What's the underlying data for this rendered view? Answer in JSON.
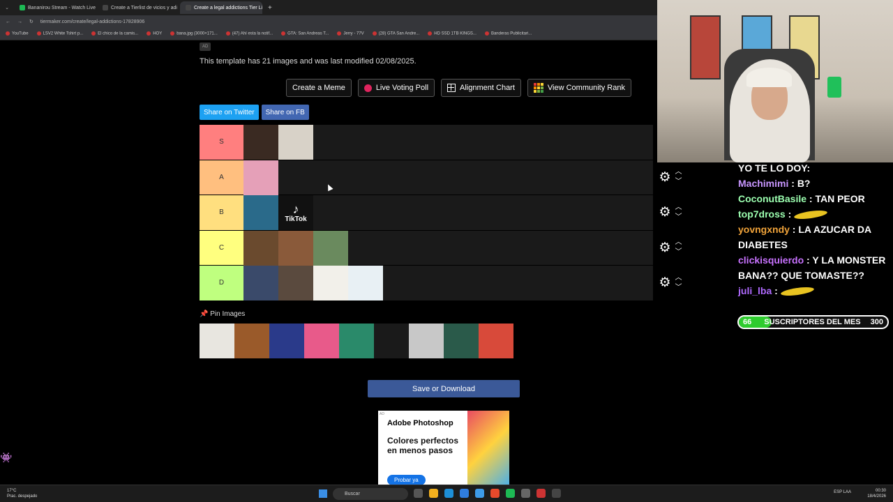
{
  "browser": {
    "tabs": [
      {
        "title": "Bananirou Stream - Watch Live",
        "color": "#1db954",
        "active": false
      },
      {
        "title": "Create a Tierlist de vicios y adi",
        "color": "#444",
        "active": false
      },
      {
        "title": "Create a legal addictions Tier Li",
        "color": "#444",
        "active": true
      }
    ],
    "url": "tiermaker.com/create/legal-addictions-17828906",
    "bookmarks": [
      "YouTube",
      "LSV2 White Tshirt p...",
      "El chico de la camis...",
      "HOY",
      "bana.jpg (3000×171...",
      "(47) Ahí esta la notif...",
      "GTA: San Andreas T...",
      "Jerry - 77V",
      "(28) GTA San Andre...",
      "HD SSD 1TB KINGS...",
      "Banderas Publicitari..."
    ]
  },
  "page": {
    "ad_badge": "AD",
    "template_info": "This template has 21 images and was last modified 02/08/2025.",
    "buttons": {
      "create_meme": "Create a Meme",
      "live_voting": "Live Voting Poll",
      "alignment": "Alignment Chart",
      "community_rank": "View Community Rank"
    },
    "share": {
      "twitter": "Share on Twitter",
      "fb": "Share on FB"
    },
    "tiers": [
      {
        "label": "S",
        "color": "#ff7f7f",
        "tiles": [
          "#3a2a22",
          "#d8d2c8"
        ]
      },
      {
        "label": "A",
        "color": "#ffbf7f",
        "tiles": [
          "#e5a0b8"
        ]
      },
      {
        "label": "B",
        "color": "#ffdf7f",
        "tiles": [
          "#2a6a8a",
          "tiktok"
        ]
      },
      {
        "label": "C",
        "color": "#ffff7f",
        "tiles": [
          "#6a4a2e",
          "#8a5a3a",
          "#6a8a5e"
        ]
      },
      {
        "label": "D",
        "color": "#bfff7f",
        "tiles": [
          "#3a4a6a",
          "#5a4a3e",
          "#f2f0ea",
          "#e8f0f4"
        ]
      }
    ],
    "tiktok_label": "TikTok",
    "pin_images": "Pin Images",
    "pin_tiles": [
      "#e8e6e0",
      "#9a5a2a",
      "#2a3a8a",
      "#e85a8a",
      "#2a8a6a",
      "#1a1a1a",
      "#c8c8c8",
      "#2a5a4a",
      "#d84a3a"
    ],
    "save_button": "Save or Download",
    "ad": {
      "adtag": "AD",
      "brand": "Adobe Photoshop",
      "tagline": "Colores perfectos en menos pasos",
      "cta": "Probar ya"
    }
  },
  "chat": {
    "messages": [
      {
        "user": "",
        "text": "YO TE LO DOY:",
        "style": "u0"
      },
      {
        "user": "Machimimi",
        "text": "B?",
        "style": "u1"
      },
      {
        "user": "CoconutBasile",
        "text": "TAN PEOR",
        "style": "u2"
      },
      {
        "user": "top7dross",
        "text": "",
        "style": "u3"
      },
      {
        "user": "yovngxndy",
        "text": "LA AZUCAR DA DIABETES",
        "style": "u4"
      },
      {
        "user": "clickisquierdo",
        "text": "Y LA MONSTER BANA?? QUE TOMASTE??",
        "style": "u5"
      },
      {
        "user": "juli_lba",
        "text": "",
        "style": "u6"
      }
    ],
    "subs": {
      "current": "66",
      "label": "SUSCRIPTORES DEL MES",
      "goal": "300",
      "progress_fraction": 0.22
    }
  },
  "taskbar": {
    "temp": "17°C",
    "weather": "Prac. despejado",
    "search": "Buscar",
    "lang": "ESP",
    "region": "LAA",
    "time": "00:30",
    "date": "18/4/2026"
  }
}
